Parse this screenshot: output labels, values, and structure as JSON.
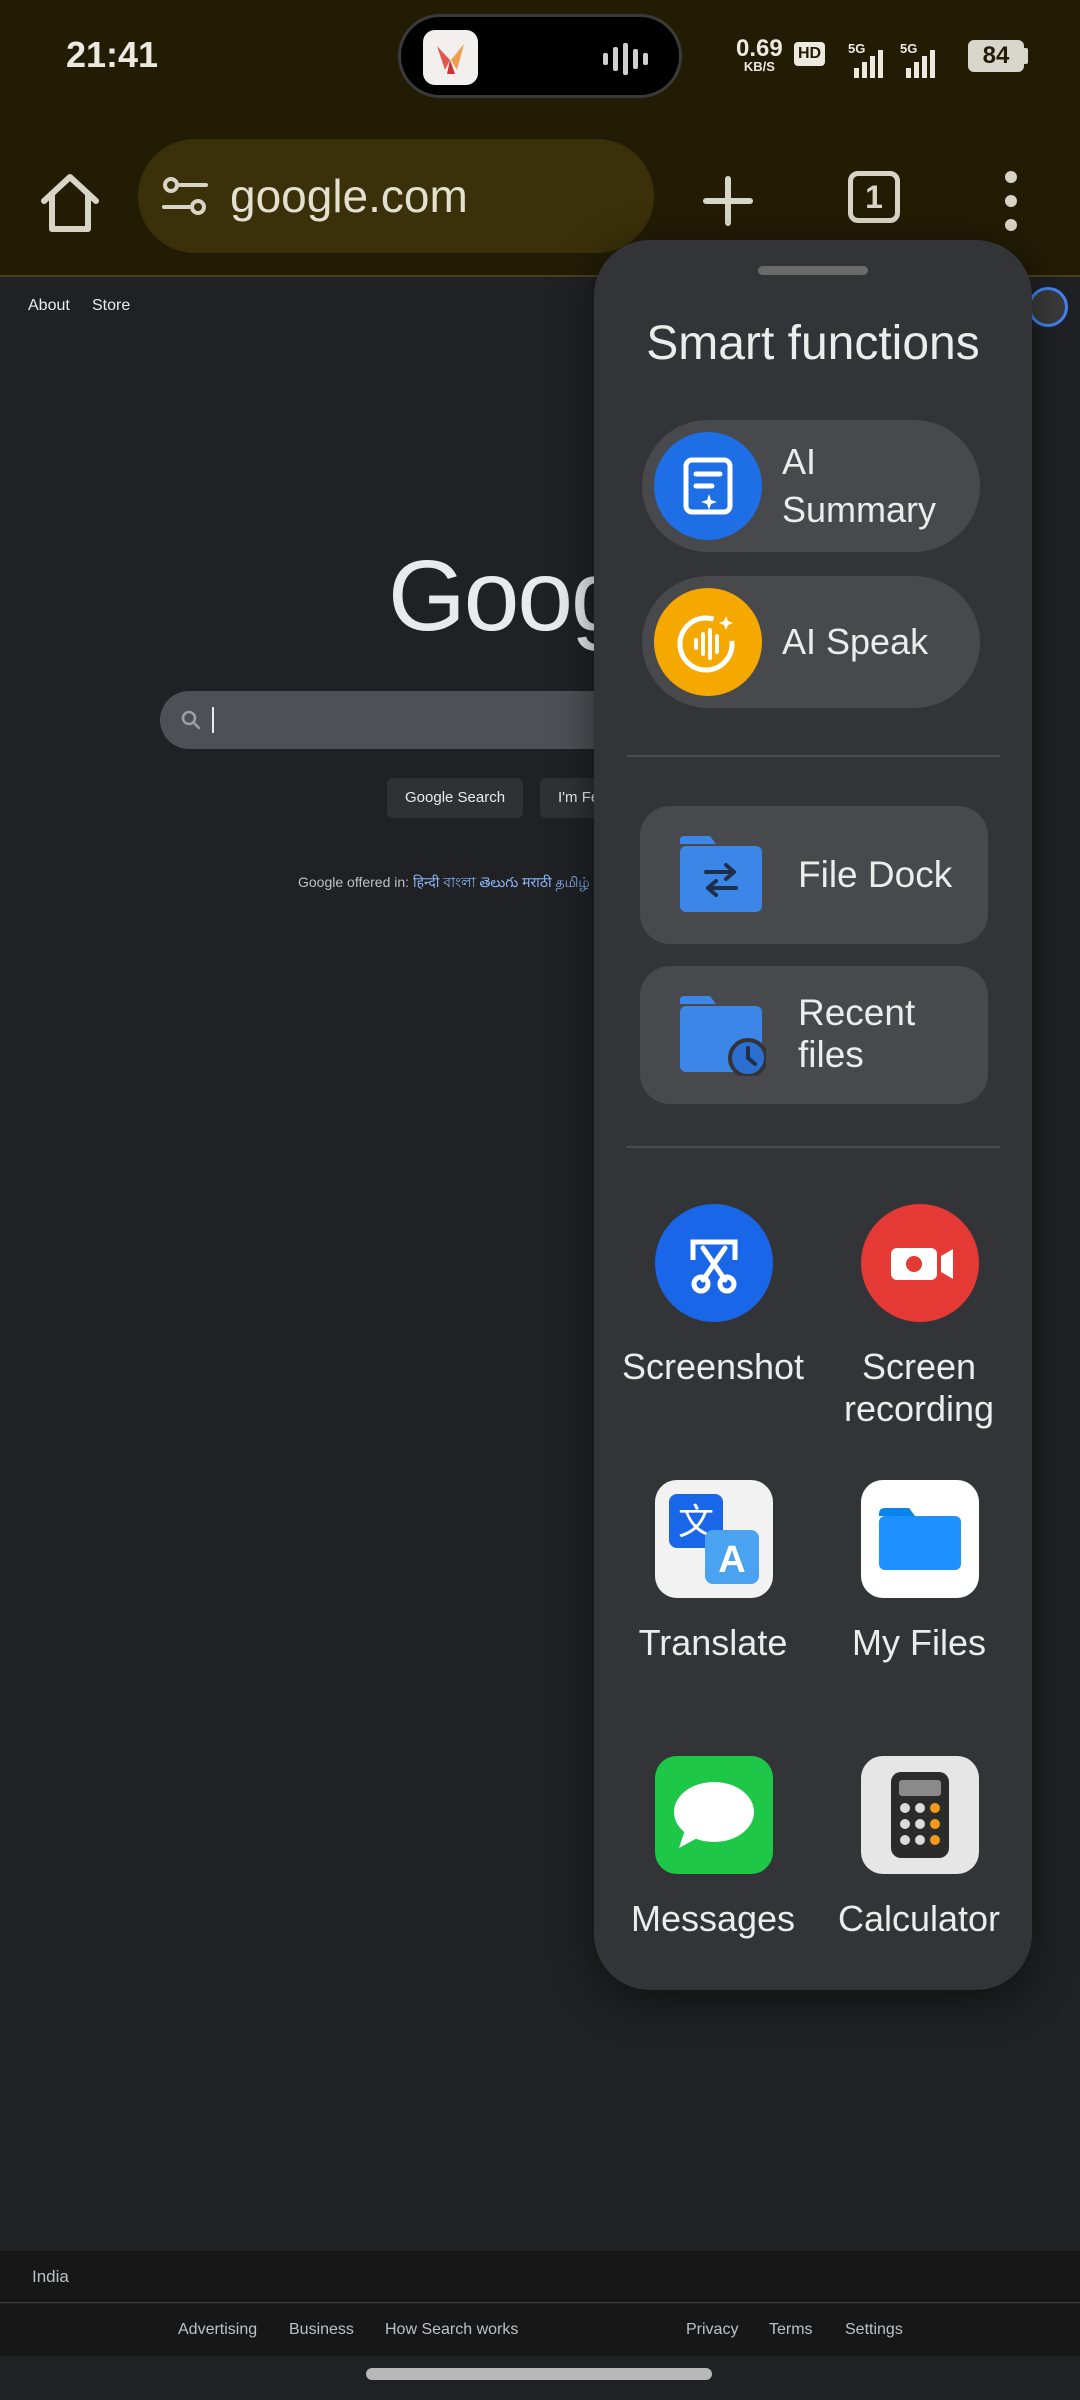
{
  "status_bar": {
    "time": "21:41",
    "speed_value": "0.69",
    "speed_unit": "KB/S",
    "hd_label": "HD",
    "network_1": "5G",
    "network_2": "5G",
    "battery": "84"
  },
  "browser": {
    "url": "google.com",
    "tab_count": "1"
  },
  "google": {
    "top_links": [
      "About",
      "Store"
    ],
    "logo_partial": "Goog",
    "search_button": "Google Search",
    "lucky_button_partial": "I'm Fe",
    "offered_prefix": "Google offered in:",
    "offered_langs": "हिन्दी বাংলা తెలుగు मराठी தமிழ்",
    "country": "India",
    "footer_links": [
      "Advertising",
      "Business",
      "How Search works",
      "Privacy",
      "Terms",
      "Settings"
    ]
  },
  "smart_panel": {
    "title": "Smart functions",
    "ai_summary": "AI Summary",
    "ai_speak": "AI Speak",
    "file_dock": "File Dock",
    "recent_files": "Recent files",
    "apps": [
      {
        "label": "Screenshot",
        "icon": "screenshot-icon"
      },
      {
        "label": "Screen recording",
        "icon": "screen-recording-icon"
      },
      {
        "label": "Translate",
        "icon": "translate-icon"
      },
      {
        "label": "My Files",
        "icon": "my-files-icon"
      },
      {
        "label": "Messages",
        "icon": "messages-icon"
      },
      {
        "label": "Calculator",
        "icon": "calculator-icon"
      }
    ],
    "colors": {
      "ai_summary": "#1e6fe6",
      "ai_speak": "#f5a800",
      "screenshot": "#1a66e8",
      "screen_recording": "#e53935",
      "messages": "#1fc748"
    }
  }
}
